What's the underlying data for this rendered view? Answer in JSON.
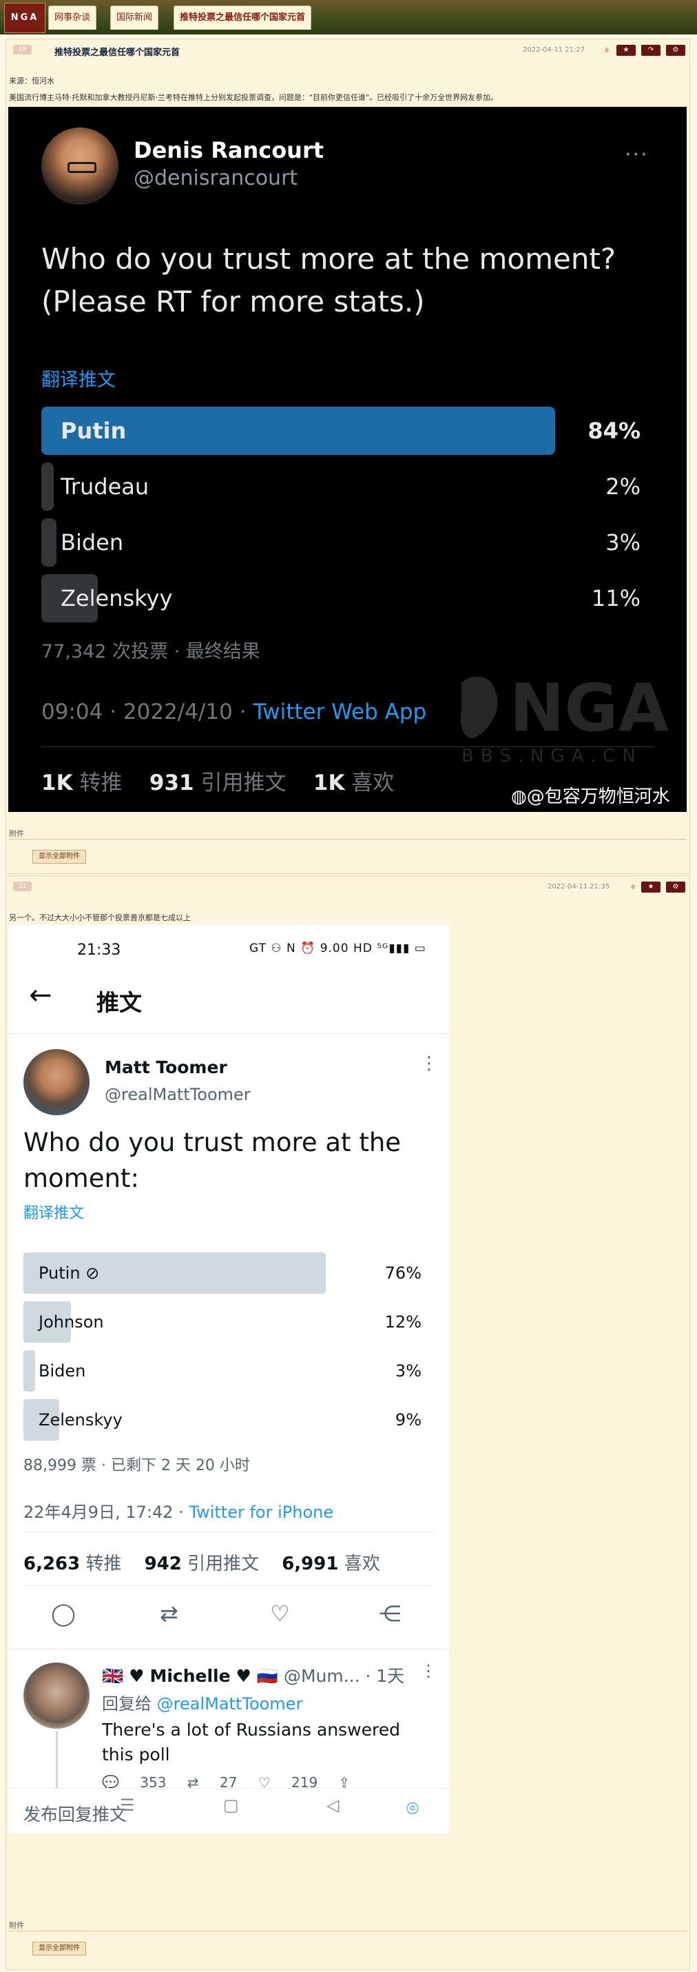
{
  "header": {
    "logo": "NGA",
    "breadcrumbs": [
      "网事杂谈",
      "国际新闻",
      "推特投票之最信任哪个国家元首"
    ]
  },
  "post1": {
    "badge": "18",
    "title": "推特投票之最信任哪个国家元首",
    "date": "2022-04-11 21:27",
    "source": "来源：恒河水",
    "body": "美国流行博主马特·托默和加拿大教授丹尼斯·兰考特在推特上分别发起投票调查，问题是：\"目前你更信任谁\"。已经吸引了十余万全世界网友参加。",
    "attachment_label": "附件",
    "show_attachments": "显示全部附件",
    "tweet": {
      "name": "Denis Rancourt",
      "handle": "@denisrancourt",
      "more": "···",
      "question": "Who do you trust more at the moment? (Please RT for more stats.)",
      "translate": "翻译推文",
      "options": [
        {
          "label": "Putin",
          "pct": "84%",
          "value": 84,
          "winner": true
        },
        {
          "label": "Trudeau",
          "pct": "2%",
          "value": 2
        },
        {
          "label": "Biden",
          "pct": "3%",
          "value": 3
        },
        {
          "label": "Zelenskyy",
          "pct": "11%",
          "value": 11
        }
      ],
      "votes": "77,342 次投票 · 最终结果",
      "time": "09:04 · 2022/4/10 · ",
      "app": "Twitter Web App",
      "retweets_n": "1K",
      "retweets_l": "转推",
      "quotes_n": "931",
      "quotes_l": "引用推文",
      "likes_n": "1K",
      "likes_l": "喜欢",
      "watermark_site": "BBS.NGA.CN",
      "watermark_weibo": "@包容万物恒河水"
    }
  },
  "post2": {
    "badge": "21",
    "date": "2022-04-11 21:35",
    "body": "另一个。不过大大小小不管那个投票普京都是七成以上",
    "attachment_label": "附件",
    "show_attachments": "显示全部附件",
    "phone": {
      "status_time": "21:33",
      "status_icons": "GT ⚇ N ⏰ 9.00 HD ⁵ᴳ▮▮▮ ▭",
      "back": "←",
      "nav_title": "推文",
      "name": "Matt Toomer",
      "handle": "@realMattToomer",
      "more": "⋮",
      "question": "Who do you trust more at the moment:",
      "translate": "翻译推文",
      "options": [
        {
          "label": "Putin ⊘",
          "pct": "76%",
          "value": 76,
          "winner": true
        },
        {
          "label": "Johnson",
          "pct": "12%",
          "value": 12
        },
        {
          "label": "Biden",
          "pct": "3%",
          "value": 3
        },
        {
          "label": "Zelenskyy",
          "pct": "9%",
          "value": 9
        }
      ],
      "votes": "88,999 票 · 已剩下 2 天 20 小时",
      "time": "22年4月9日, 17:42 · ",
      "app": "Twitter for iPhone",
      "retweets_n": "6,263",
      "retweets_l": "转推",
      "quotes_n": "942",
      "quotes_l": "引用推文",
      "likes_n": "6,991",
      "likes_l": "喜欢",
      "actions": [
        "reply-icon",
        "retweet-icon",
        "like-icon",
        "share-icon"
      ],
      "reply": {
        "name_prefix": "🇬🇧 ♥ ",
        "name": "Michelle",
        "name_suffix": " ♥ 🇷🇺 ",
        "handle": "@Mum... · 1天",
        "more": "⋮",
        "reply_to_prefix": "回复给 ",
        "reply_to": "@realMattToomer",
        "text": "There's a lot of Russians answered this poll",
        "acts": "💬 353 ⇄ 27 ♡ 219 ⇪"
      },
      "compose_placeholder": "发布回复推文",
      "nav_buttons": [
        "☰",
        "▢",
        "◁"
      ]
    }
  },
  "colors": {
    "header_bg": "#3e4c1d",
    "post_bg": "#fdf4dc",
    "twitter_blue": "#1d9bf0",
    "poll_winner_dark": "#1d6ca8",
    "button_dark_red": "#6a1412"
  }
}
